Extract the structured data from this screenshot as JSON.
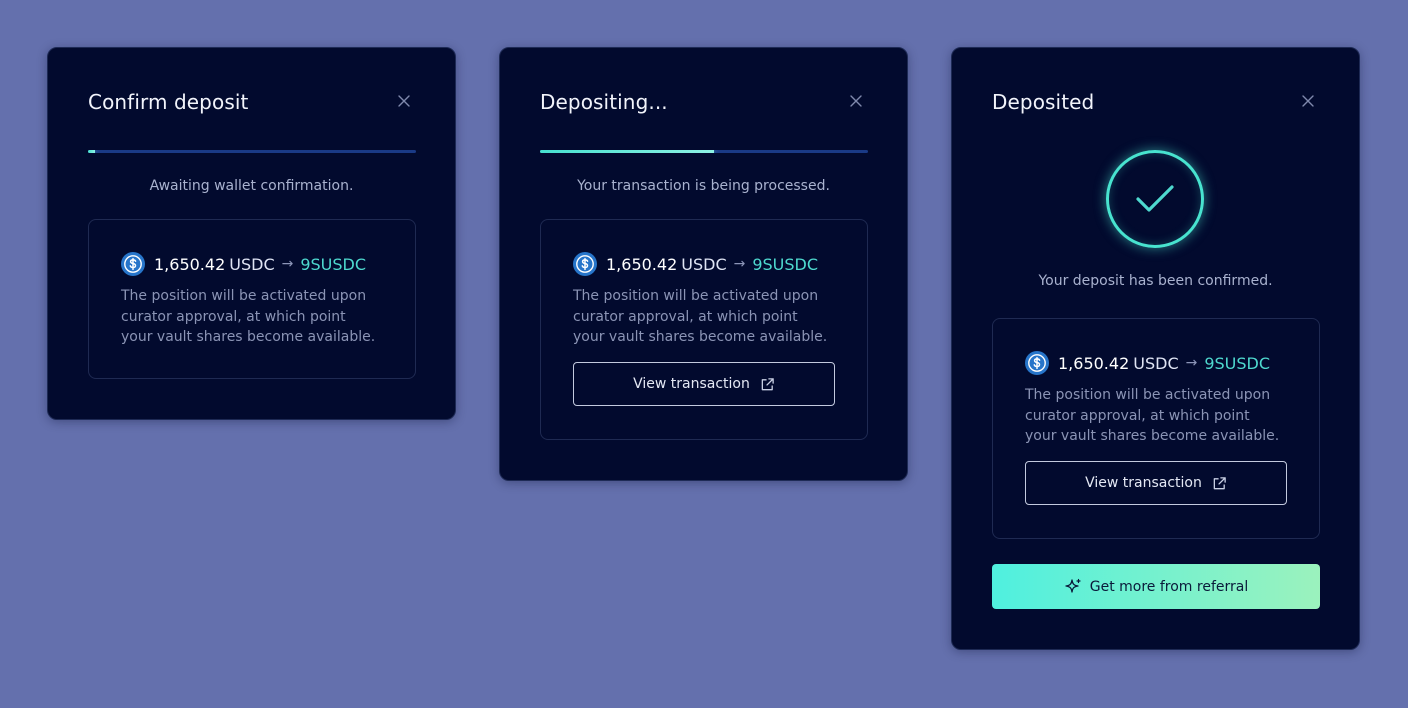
{
  "colors": {
    "background": "#6470ad",
    "modal_bg": "#020a2e",
    "accent": "#4ed9cf",
    "progress_track": "#1a3a86"
  },
  "modals": [
    {
      "title": "Confirm deposit",
      "progress": 0.02,
      "status": "Awaiting wallet confirmation.",
      "amount": "1,650.42",
      "from_unit": "USDC",
      "to_unit": "9SUSDC",
      "description": "The position will be activated upon curator approval, at which point your vault shares become available."
    },
    {
      "title": "Depositing...",
      "progress": 0.53,
      "status": "Your transaction is being processed.",
      "amount": "1,650.42",
      "from_unit": "USDC",
      "to_unit": "9SUSDC",
      "description": "The position will be activated upon curator approval, at which point your vault shares become available.",
      "view_label": "View transaction"
    },
    {
      "title": "Deposited",
      "status": "Your deposit has been confirmed.",
      "amount": "1,650.42",
      "from_unit": "USDC",
      "to_unit": "9SUSDC",
      "description": "The position will be activated upon curator approval, at which point your vault shares become available.",
      "view_label": "View transaction",
      "referral_label": "Get more from referral"
    }
  ],
  "icons": {
    "close": "close-icon",
    "token": "usdc-icon",
    "arrow": "arrow-right-icon",
    "external": "external-link-icon",
    "check": "check-icon",
    "sparkle": "sparkle-icon"
  }
}
